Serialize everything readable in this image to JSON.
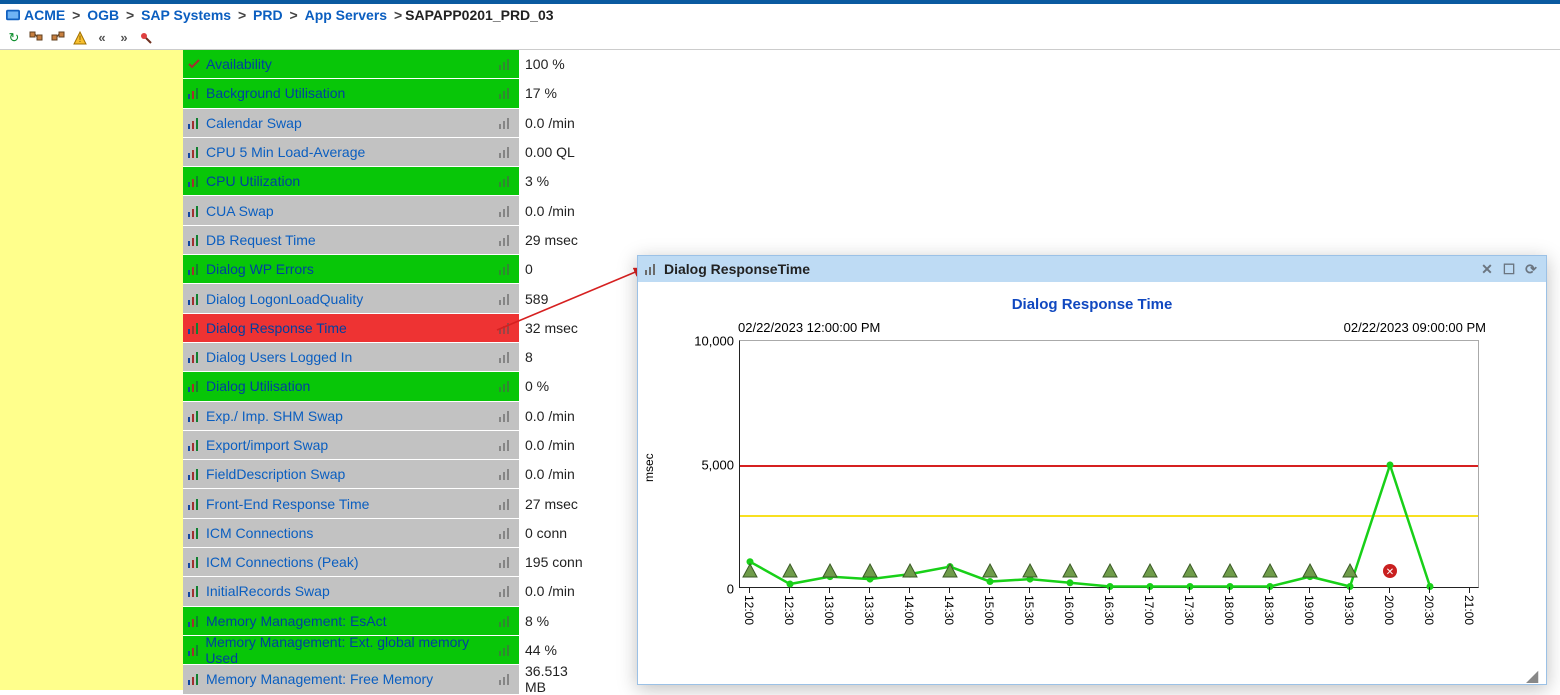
{
  "breadcrumb": {
    "items": [
      "ACME",
      "OGB",
      "SAP Systems",
      "PRD",
      "App Servers"
    ],
    "current": "SAPAPP0201_PRD_03"
  },
  "toolbar_icons": [
    "refresh",
    "tree-expand",
    "tree-collapse",
    "warning",
    "chevron-left",
    "chevron-right",
    "pin"
  ],
  "metrics": [
    {
      "name": "Availability",
      "value": "100 %",
      "status": "green",
      "icon": "check"
    },
    {
      "name": "Background Utilisation",
      "value": "17 %",
      "status": "green",
      "icon": "bars"
    },
    {
      "name": "Calendar Swap",
      "value": "0.0 /min",
      "status": "grey",
      "icon": "bars"
    },
    {
      "name": "CPU 5 Min Load-Average",
      "value": "0.00 QL",
      "status": "grey",
      "icon": "bars"
    },
    {
      "name": "CPU Utilization",
      "value": "3 %",
      "status": "green",
      "icon": "bars"
    },
    {
      "name": "CUA Swap",
      "value": "0.0 /min",
      "status": "grey",
      "icon": "bars"
    },
    {
      "name": "DB Request Time",
      "value": "29 msec",
      "status": "grey",
      "icon": "bars"
    },
    {
      "name": "Dialog WP Errors",
      "value": "0",
      "status": "green",
      "icon": "bars"
    },
    {
      "name": "Dialog LogonLoadQuality",
      "value": "589",
      "status": "grey",
      "icon": "bars"
    },
    {
      "name": "Dialog Response Time",
      "value": "32 msec",
      "status": "red",
      "icon": "bars"
    },
    {
      "name": "Dialog Users Logged In",
      "value": "8",
      "status": "grey",
      "icon": "bars"
    },
    {
      "name": "Dialog Utilisation",
      "value": "0 %",
      "status": "green",
      "icon": "bars"
    },
    {
      "name": "Exp./ Imp. SHM Swap",
      "value": "0.0 /min",
      "status": "grey",
      "icon": "bars"
    },
    {
      "name": "Export/import Swap",
      "value": "0.0 /min",
      "status": "grey",
      "icon": "bars"
    },
    {
      "name": "FieldDescription Swap",
      "value": "0.0 /min",
      "status": "grey",
      "icon": "bars"
    },
    {
      "name": "Front-End Response Time",
      "value": "27 msec",
      "status": "grey",
      "icon": "bars"
    },
    {
      "name": "ICM Connections",
      "value": "0 conn",
      "status": "grey",
      "icon": "bars"
    },
    {
      "name": "ICM Connections (Peak)",
      "value": "195 conn",
      "status": "grey",
      "icon": "bars"
    },
    {
      "name": "InitialRecords Swap",
      "value": "0.0 /min",
      "status": "grey",
      "icon": "bars"
    },
    {
      "name": "Memory Management: EsAct",
      "value": "8 %",
      "status": "green",
      "icon": "bars"
    },
    {
      "name": "Memory Management: Ext. global memory Used",
      "value": "44 %",
      "status": "green",
      "icon": "bars"
    },
    {
      "name": "Memory Management: Free Memory",
      "value": "36.513 MB",
      "status": "grey",
      "icon": "bars"
    }
  ],
  "chart_panel": {
    "header": "Dialog ResponseTime",
    "title": "Dialog Response Time",
    "time_from": "02/22/2023 12:00:00 PM",
    "time_to": "02/22/2023 09:00:00 PM",
    "ylabel": "msec"
  },
  "chart_data": {
    "type": "line",
    "title": "Dialog Response Time",
    "xlabel": "",
    "ylabel": "msec",
    "ylim": [
      0,
      10000
    ],
    "yticks": [
      0,
      5000,
      10000
    ],
    "xticks": [
      "12:00",
      "12:30",
      "13:00",
      "13:30",
      "14:00",
      "14:30",
      "15:00",
      "15:30",
      "16:00",
      "16:30",
      "17:00",
      "17:30",
      "18:00",
      "18:30",
      "19:00",
      "19:30",
      "20:00",
      "20:30",
      "21:00"
    ],
    "thresholds": {
      "warning": 3000,
      "critical": 5000
    },
    "series": [
      {
        "name": "Dialog Response Time",
        "color": "#18d018",
        "values": [
          1100,
          200,
          500,
          400,
          600,
          900,
          300,
          400,
          250,
          100,
          100,
          100,
          100,
          100,
          500,
          100,
          5000,
          100
        ]
      }
    ],
    "markers": [
      {
        "x_index": 0,
        "type": "ok"
      },
      {
        "x_index": 1,
        "type": "ok"
      },
      {
        "x_index": 2,
        "type": "ok"
      },
      {
        "x_index": 3,
        "type": "ok"
      },
      {
        "x_index": 4,
        "type": "ok"
      },
      {
        "x_index": 5,
        "type": "ok"
      },
      {
        "x_index": 6,
        "type": "ok"
      },
      {
        "x_index": 7,
        "type": "ok"
      },
      {
        "x_index": 8,
        "type": "ok"
      },
      {
        "x_index": 9,
        "type": "ok"
      },
      {
        "x_index": 10,
        "type": "ok"
      },
      {
        "x_index": 11,
        "type": "ok"
      },
      {
        "x_index": 12,
        "type": "ok"
      },
      {
        "x_index": 13,
        "type": "ok"
      },
      {
        "x_index": 14,
        "type": "ok"
      },
      {
        "x_index": 15,
        "type": "ok"
      },
      {
        "x_index": 16,
        "type": "error"
      }
    ]
  }
}
